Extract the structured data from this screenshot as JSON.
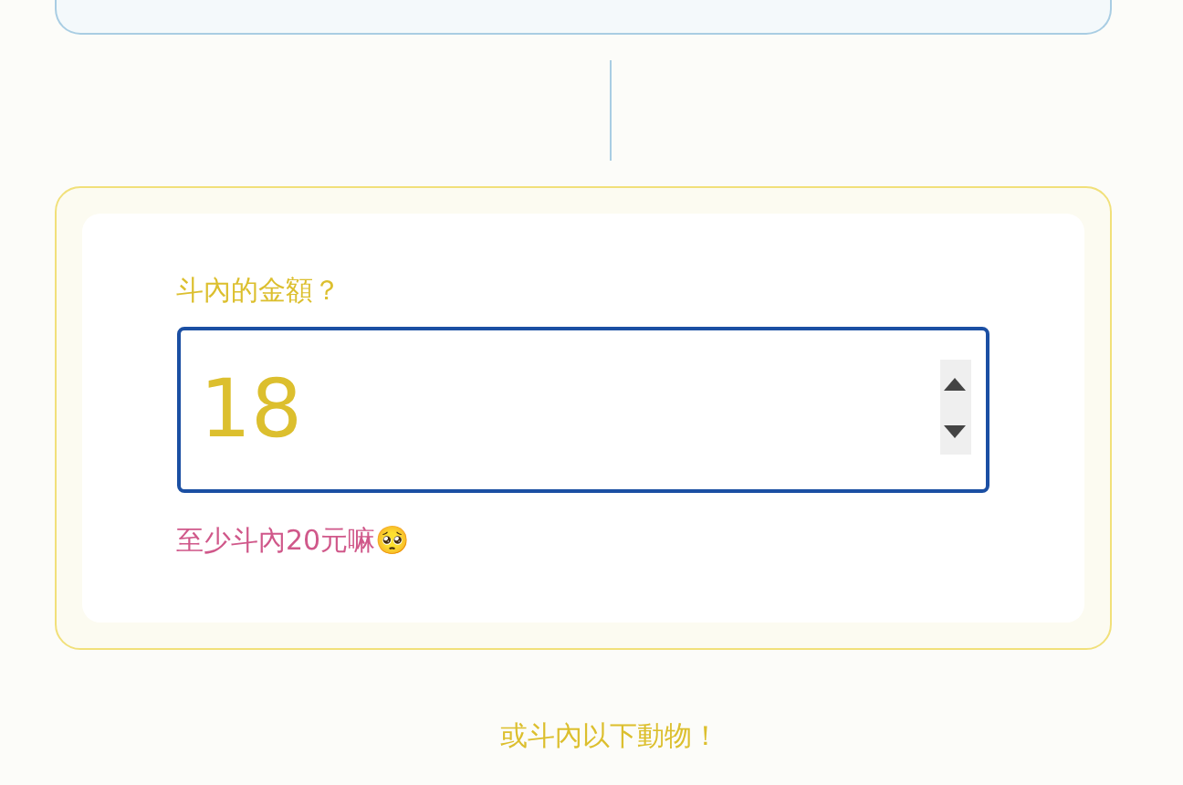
{
  "amount_field": {
    "label": "斗內的金額？",
    "value": "18",
    "error": "至少斗內20元嘛🥺"
  },
  "footer_text": "或斗內以下動物！"
}
